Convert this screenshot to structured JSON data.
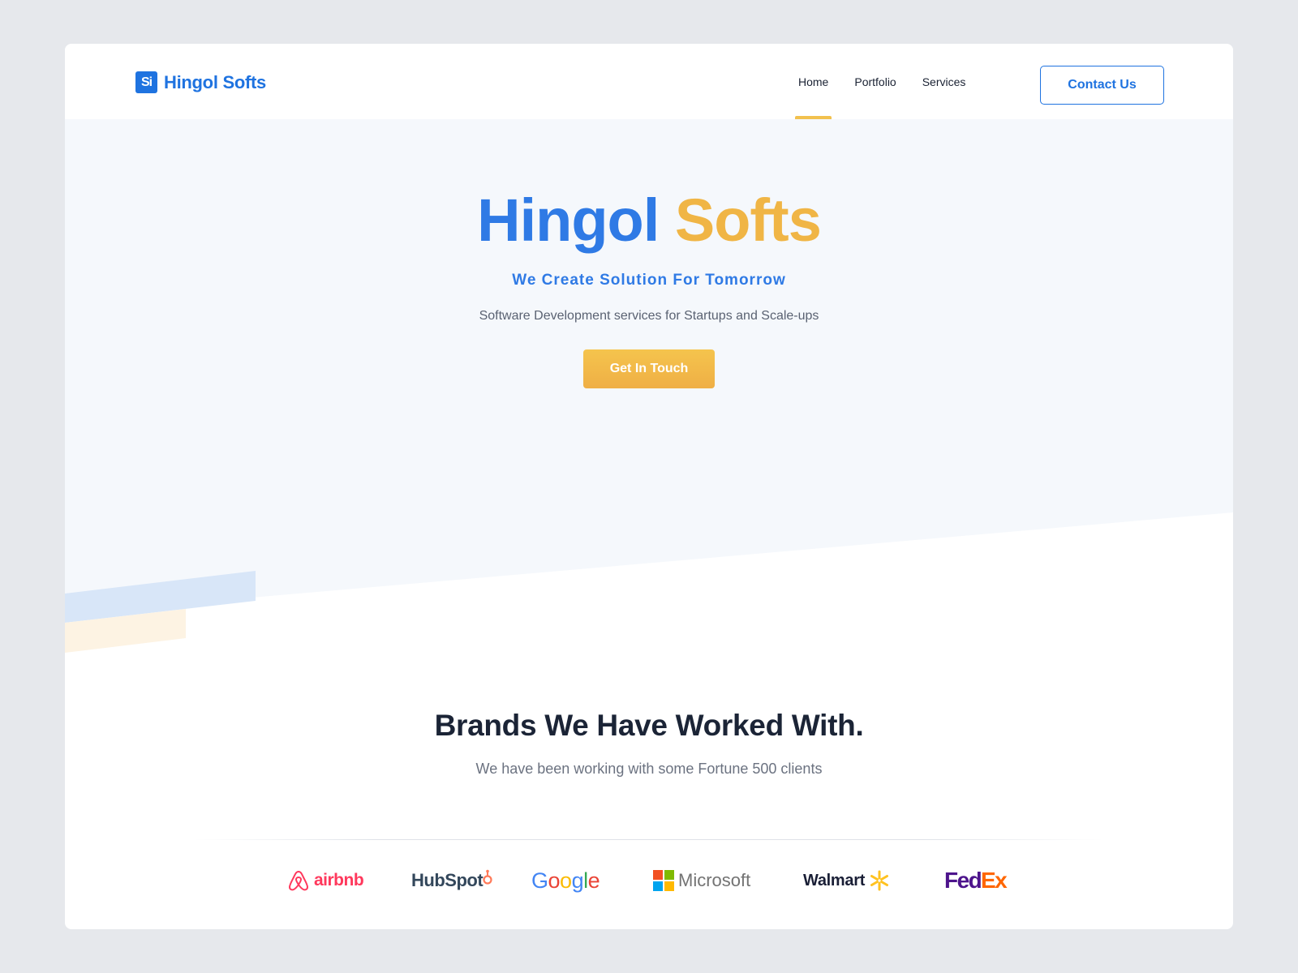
{
  "header": {
    "logo_text": "Hingol Softs",
    "logo_mark": "Si",
    "nav": [
      {
        "label": "Home",
        "active": true
      },
      {
        "label": "Portfolio",
        "active": false
      },
      {
        "label": "Services",
        "active": false
      }
    ],
    "contact_label": "Contact Us"
  },
  "hero": {
    "title_part1": "Hingol",
    "title_part2": "Softs",
    "tagline": "We Create Solution For Tomorrow",
    "description": "Software Development services for Startups and Scale-ups",
    "cta_label": "Get In Touch"
  },
  "brands": {
    "title": "Brands We Have Worked With.",
    "subtitle": "We have been working with some Fortune 500 clients",
    "logos": [
      {
        "name": "airbnb",
        "icon": "airbnb-icon",
        "color": "#ff385c"
      },
      {
        "name": "HubSpot",
        "icon": "hubspot-icon",
        "color": "#33475b"
      },
      {
        "name": "Google",
        "icon": "google-icon",
        "color": "#4285f4"
      },
      {
        "name": "Microsoft",
        "icon": "microsoft-icon",
        "color": "#737373"
      },
      {
        "name": "Walmart",
        "icon": "walmart-spark-icon",
        "color": "#1a1f36"
      },
      {
        "name": "FedEx",
        "icon": "fedex-icon",
        "color": "#4d148c"
      }
    ]
  },
  "colors": {
    "brand_blue": "#1f73e0",
    "brand_yellow": "#f0b545",
    "hero_bg": "#f5f8fc",
    "accent_blue_band": "#d8e6f8",
    "accent_yellow_band": "#fdf3e3"
  }
}
